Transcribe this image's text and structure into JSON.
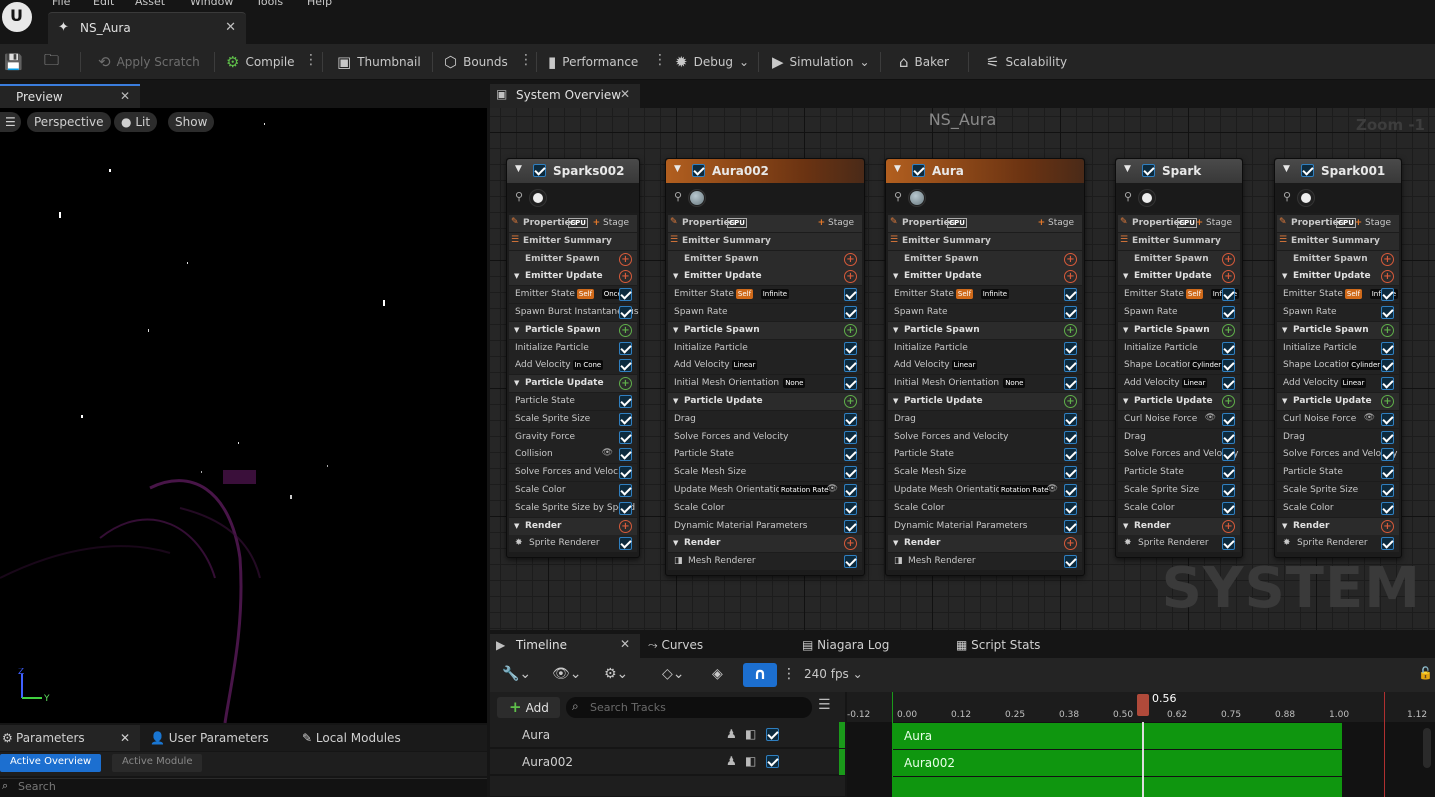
{
  "menu": [
    "File",
    "Edit",
    "Asset",
    "Window",
    "Tools",
    "Help"
  ],
  "document_tab": "NS_Aura",
  "toolbar": {
    "apply_scratch": "Apply Scratch",
    "compile": "Compile",
    "thumbnail": "Thumbnail",
    "bounds": "Bounds",
    "performance": "Performance",
    "debug": "Debug",
    "simulation": "Simulation",
    "baker": "Baker",
    "scalability": "Scalability"
  },
  "preview": {
    "tab": "Preview",
    "perspective": "Perspective",
    "lit": "Lit",
    "show": "Show",
    "axis_z": "Z",
    "axis_y": "Y"
  },
  "params": {
    "tabs": [
      "Parameters",
      "User Parameters",
      "Local Modules"
    ],
    "filter_active": "Active Overview",
    "filter_module": "Active Module",
    "search_placeholder": "Search"
  },
  "system_overview": {
    "tab": "System Overview",
    "title": "NS_Aura",
    "zoom": "Zoom -1",
    "watermark": "SYSTEM"
  },
  "emitters": [
    {
      "name": "Sparks002",
      "rows": [
        {
          "k": "prop",
          "t": "Properties",
          "cpu": "CPU",
          "stage": "Stage"
        },
        {
          "k": "summ",
          "t": "Emitter Summary"
        },
        {
          "k": "spawn",
          "t": "Emitter Spawn",
          "plus": "red"
        },
        {
          "k": "sec",
          "t": "Emitter Update",
          "plus": "red"
        },
        {
          "k": "mod",
          "t": "Emitter State",
          "tags": [
            "Self",
            "Once"
          ],
          "chk": true
        },
        {
          "k": "mod",
          "t": "Spawn Burst Instantaneous",
          "chk": true
        },
        {
          "k": "sec",
          "t": "Particle Spawn",
          "plus": "green"
        },
        {
          "k": "mod",
          "t": "Initialize Particle",
          "chk": true
        },
        {
          "k": "mod",
          "t": "Add Velocity",
          "tags": [
            "In Cone"
          ],
          "chk": true
        },
        {
          "k": "sec",
          "t": "Particle Update",
          "plus": "green"
        },
        {
          "k": "mod",
          "t": "Particle State",
          "chk": true
        },
        {
          "k": "mod",
          "t": "Scale Sprite Size",
          "chk": true
        },
        {
          "k": "mod",
          "t": "Gravity Force",
          "chk": true
        },
        {
          "k": "mod",
          "t": "Collision",
          "eye": true,
          "chk": true
        },
        {
          "k": "mod",
          "t": "Solve Forces and Velocity",
          "chk": true
        },
        {
          "k": "mod",
          "t": "Scale Color",
          "chk": true
        },
        {
          "k": "mod",
          "t": "Scale Sprite Size by Speed",
          "chk": true
        },
        {
          "k": "sec",
          "t": "Render",
          "plus": "red"
        },
        {
          "k": "mod",
          "t": "Sprite Renderer",
          "icon": "sprite",
          "chk": true
        }
      ]
    },
    {
      "name": "Aura002",
      "rows": [
        {
          "k": "prop",
          "t": "Properties",
          "cpu": "CPU",
          "stage": "Stage"
        },
        {
          "k": "summ",
          "t": "Emitter Summary"
        },
        {
          "k": "spawn",
          "t": "Emitter Spawn",
          "plus": "red"
        },
        {
          "k": "sec",
          "t": "Emitter Update",
          "plus": "red"
        },
        {
          "k": "mod",
          "t": "Emitter State",
          "tags": [
            "Self",
            "Infinite"
          ],
          "chk": true
        },
        {
          "k": "mod",
          "t": "Spawn Rate",
          "chk": true
        },
        {
          "k": "sec",
          "t": "Particle Spawn",
          "plus": "green"
        },
        {
          "k": "mod",
          "t": "Initialize Particle",
          "chk": true
        },
        {
          "k": "mod",
          "t": "Add Velocity",
          "tags": [
            "Linear"
          ],
          "chk": true
        },
        {
          "k": "mod",
          "t": "Initial Mesh Orientation",
          "tags": [
            "None"
          ],
          "chk": true
        },
        {
          "k": "sec",
          "t": "Particle Update",
          "plus": "green"
        },
        {
          "k": "mod",
          "t": "Drag",
          "chk": true
        },
        {
          "k": "mod",
          "t": "Solve Forces and Velocity",
          "chk": true
        },
        {
          "k": "mod",
          "t": "Particle State",
          "chk": true
        },
        {
          "k": "mod",
          "t": "Scale Mesh Size",
          "chk": true
        },
        {
          "k": "mod",
          "t": "Update Mesh Orientation",
          "tags": [
            "Rotation Rate"
          ],
          "eye": true,
          "chk": true
        },
        {
          "k": "mod",
          "t": "Scale Color",
          "chk": true
        },
        {
          "k": "mod",
          "t": "Dynamic Material Parameters",
          "chk": true
        },
        {
          "k": "sec",
          "t": "Render",
          "plus": "red"
        },
        {
          "k": "mod",
          "t": "Mesh Renderer",
          "icon": "mesh",
          "chk": true
        }
      ]
    },
    {
      "name": "Aura",
      "rows": [
        {
          "k": "prop",
          "t": "Properties",
          "cpu": "CPU",
          "stage": "Stage"
        },
        {
          "k": "summ",
          "t": "Emitter Summary"
        },
        {
          "k": "spawn",
          "t": "Emitter Spawn",
          "plus": "red"
        },
        {
          "k": "sec",
          "t": "Emitter Update",
          "plus": "red"
        },
        {
          "k": "mod",
          "t": "Emitter State",
          "tags": [
            "Self",
            "Infinite"
          ],
          "chk": true
        },
        {
          "k": "mod",
          "t": "Spawn Rate",
          "chk": true
        },
        {
          "k": "sec",
          "t": "Particle Spawn",
          "plus": "green"
        },
        {
          "k": "mod",
          "t": "Initialize Particle",
          "chk": true
        },
        {
          "k": "mod",
          "t": "Add Velocity",
          "tags": [
            "Linear"
          ],
          "chk": true
        },
        {
          "k": "mod",
          "t": "Initial Mesh Orientation",
          "tags": [
            "None"
          ],
          "chk": true
        },
        {
          "k": "sec",
          "t": "Particle Update",
          "plus": "green"
        },
        {
          "k": "mod",
          "t": "Drag",
          "chk": true
        },
        {
          "k": "mod",
          "t": "Solve Forces and Velocity",
          "chk": true
        },
        {
          "k": "mod",
          "t": "Particle State",
          "chk": true
        },
        {
          "k": "mod",
          "t": "Scale Mesh Size",
          "chk": true
        },
        {
          "k": "mod",
          "t": "Update Mesh Orientation",
          "tags": [
            "Rotation Rate"
          ],
          "eye": true,
          "chk": true
        },
        {
          "k": "mod",
          "t": "Scale Color",
          "chk": true
        },
        {
          "k": "mod",
          "t": "Dynamic Material Parameters",
          "chk": true
        },
        {
          "k": "sec",
          "t": "Render",
          "plus": "red"
        },
        {
          "k": "mod",
          "t": "Mesh Renderer",
          "icon": "mesh",
          "chk": true
        }
      ]
    },
    {
      "name": "Spark",
      "rows": [
        {
          "k": "prop",
          "t": "Properties",
          "cpu": "CPU",
          "stage": "Stage"
        },
        {
          "k": "summ",
          "t": "Emitter Summary"
        },
        {
          "k": "spawn",
          "t": "Emitter Spawn",
          "plus": "red"
        },
        {
          "k": "sec",
          "t": "Emitter Update",
          "plus": "red"
        },
        {
          "k": "mod",
          "t": "Emitter State",
          "tags": [
            "Self",
            "Infinite"
          ],
          "chk": true
        },
        {
          "k": "mod",
          "t": "Spawn Rate",
          "chk": true
        },
        {
          "k": "sec",
          "t": "Particle Spawn",
          "plus": "green"
        },
        {
          "k": "mod",
          "t": "Initialize Particle",
          "chk": true
        },
        {
          "k": "mod",
          "t": "Shape Location",
          "tags": [
            "Cylinder"
          ],
          "chk": true
        },
        {
          "k": "mod",
          "t": "Add Velocity",
          "tags": [
            "Linear"
          ],
          "chk": true
        },
        {
          "k": "sec",
          "t": "Particle Update",
          "plus": "green"
        },
        {
          "k": "mod",
          "t": "Curl Noise Force",
          "eye": true,
          "chk": true
        },
        {
          "k": "mod",
          "t": "Drag",
          "chk": true
        },
        {
          "k": "mod",
          "t": "Solve Forces and Velocity",
          "chk": true
        },
        {
          "k": "mod",
          "t": "Particle State",
          "chk": true
        },
        {
          "k": "mod",
          "t": "Scale Sprite Size",
          "chk": true
        },
        {
          "k": "mod",
          "t": "Scale Color",
          "chk": true
        },
        {
          "k": "sec",
          "t": "Render",
          "plus": "red"
        },
        {
          "k": "mod",
          "t": "Sprite Renderer",
          "icon": "sprite",
          "chk": true
        }
      ]
    },
    {
      "name": "Spark001",
      "rows": [
        {
          "k": "prop",
          "t": "Properties",
          "cpu": "CPU",
          "stage": "Stage"
        },
        {
          "k": "summ",
          "t": "Emitter Summary"
        },
        {
          "k": "spawn",
          "t": "Emitter Spawn",
          "plus": "red"
        },
        {
          "k": "sec",
          "t": "Emitter Update",
          "plus": "red"
        },
        {
          "k": "mod",
          "t": "Emitter State",
          "tags": [
            "Self",
            "Infinite"
          ],
          "chk": true
        },
        {
          "k": "mod",
          "t": "Spawn Rate",
          "chk": true
        },
        {
          "k": "sec",
          "t": "Particle Spawn",
          "plus": "green"
        },
        {
          "k": "mod",
          "t": "Initialize Particle",
          "chk": true
        },
        {
          "k": "mod",
          "t": "Shape Location",
          "tags": [
            "Cylinder"
          ],
          "chk": true
        },
        {
          "k": "mod",
          "t": "Add Velocity",
          "tags": [
            "Linear"
          ],
          "chk": true
        },
        {
          "k": "sec",
          "t": "Particle Update",
          "plus": "green"
        },
        {
          "k": "mod",
          "t": "Curl Noise Force",
          "eye": true,
          "chk": true
        },
        {
          "k": "mod",
          "t": "Drag",
          "chk": true
        },
        {
          "k": "mod",
          "t": "Solve Forces and Velocity",
          "chk": true
        },
        {
          "k": "mod",
          "t": "Particle State",
          "chk": true
        },
        {
          "k": "mod",
          "t": "Scale Sprite Size",
          "chk": true
        },
        {
          "k": "mod",
          "t": "Scale Color",
          "chk": true
        },
        {
          "k": "sec",
          "t": "Render",
          "plus": "red"
        },
        {
          "k": "mod",
          "t": "Sprite Renderer",
          "icon": "sprite",
          "chk": true
        }
      ]
    }
  ],
  "timeline": {
    "tabs": [
      "Timeline",
      "Curves",
      "Niagara Log",
      "Script Stats"
    ],
    "fps": "240 fps",
    "add": "Add",
    "search_placeholder": "Search Tracks",
    "playhead": "0.56",
    "ticks": [
      "-0.12",
      "0.00",
      "0.12",
      "0.25",
      "0.38",
      "0.50",
      "0.62",
      "0.75",
      "0.88",
      "1.00",
      "1.12"
    ],
    "tracks": [
      "Aura",
      "Aura002"
    ]
  }
}
